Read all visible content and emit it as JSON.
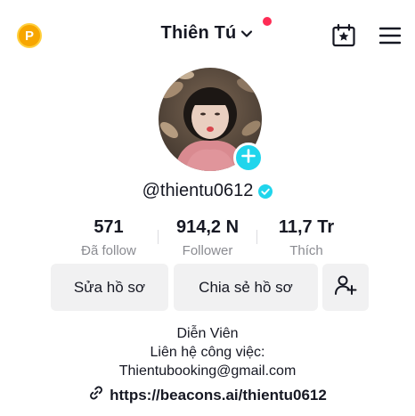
{
  "header": {
    "coin_symbol": "P",
    "username_title": "Thiên Tú",
    "has_notification_dot": true
  },
  "profile": {
    "handle": "@thientu0612",
    "verified": true
  },
  "stats": [
    {
      "value": "571",
      "label": "Đã follow"
    },
    {
      "value": "914,2 N",
      "label": "Follower"
    },
    {
      "value": "11,7 Tr",
      "label": "Thích"
    }
  ],
  "buttons": {
    "edit_profile": "Sửa hồ sơ",
    "share_profile": "Chia sẻ hồ sơ"
  },
  "bio": {
    "line1": "Diễn Viên",
    "line2": "Liên hệ công việc:",
    "line3": "Thientubooking@gmail.com"
  },
  "link": {
    "url": "https://beacons.ai/thientu0612"
  },
  "colors": {
    "accent_cyan": "#20d5ec",
    "notification_red": "#fe2c55",
    "coin_gold": "#f7a600",
    "muted_text": "#8a8b91",
    "button_bg": "#f1f1f2"
  },
  "icons": [
    "coin-icon",
    "chevron-down-icon",
    "calendar-star-icon",
    "hamburger-menu-icon",
    "plus-icon",
    "verified-icon",
    "add-friend-icon",
    "link-icon"
  ]
}
